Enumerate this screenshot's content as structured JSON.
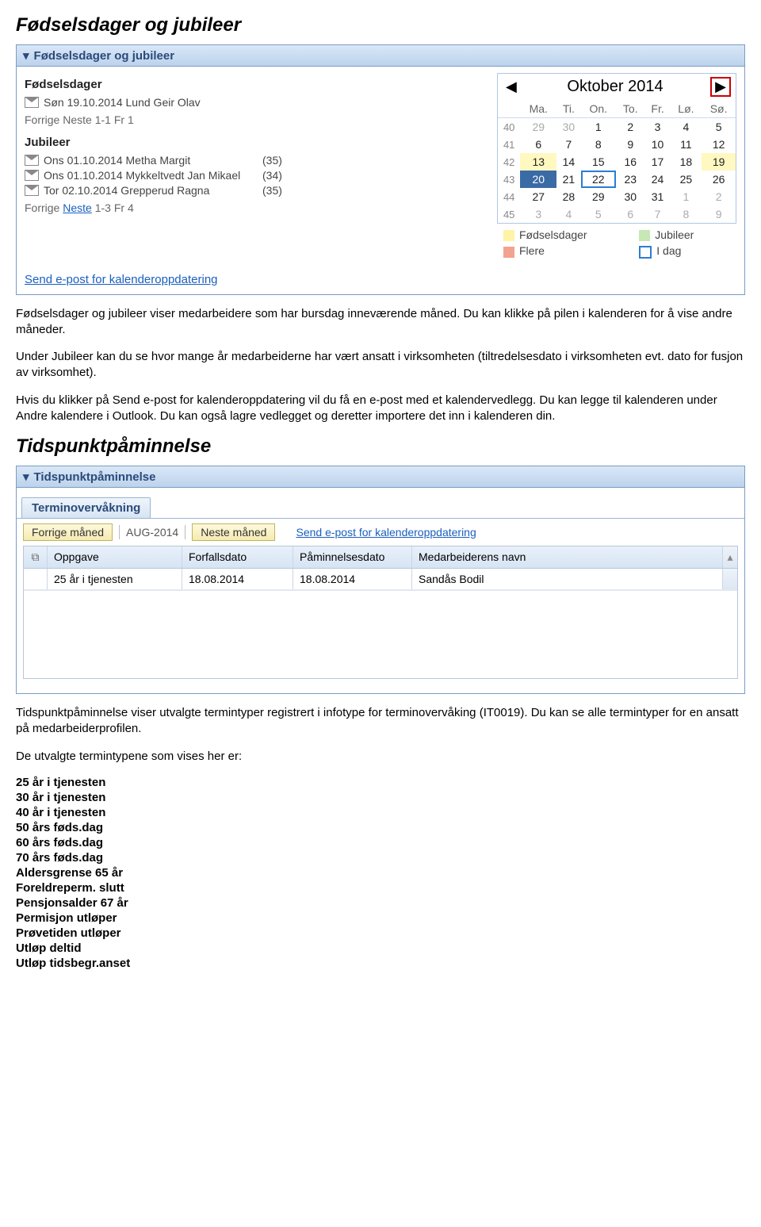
{
  "section1": {
    "heading": "Fødselsdager og jubileer",
    "panel_title": "Fødselsdager og jubileer",
    "fodselsdager_label": "Fødselsdager",
    "fodselsdager_entries": [
      "Søn 19.10.2014 Lund Geir Olav"
    ],
    "fodselsdager_pager": {
      "forrige": "Forrige",
      "neste": "Neste",
      "range": "1-1 Fr 1"
    },
    "jubileer_label": "Jubileer",
    "jubileer_entries": [
      {
        "text": "Ons 01.10.2014 Metha Margit",
        "age": "(35)"
      },
      {
        "text": "Ons 01.10.2014 Mykkeltvedt Jan Mikael",
        "age": "(34)"
      },
      {
        "text": "Tor  02.10.2014 Grepperud Ragna",
        "age": "(35)"
      }
    ],
    "jubileer_pager": {
      "forrige": "Forrige",
      "neste": "Neste",
      "range": "1-3 Fr 4"
    },
    "send_link": "Send e-post for kalenderoppdatering",
    "calendar": {
      "month_title": "Oktober 2014",
      "dow": [
        "Ma.",
        "Ti.",
        "On.",
        "To.",
        "Fr.",
        "Lø.",
        "Sø."
      ],
      "weeks": [
        {
          "wk": "40",
          "days": [
            {
              "d": "29",
              "dim": true
            },
            {
              "d": "30",
              "dim": true
            },
            {
              "d": "1"
            },
            {
              "d": "2"
            },
            {
              "d": "3"
            },
            {
              "d": "4"
            },
            {
              "d": "5"
            }
          ]
        },
        {
          "wk": "41",
          "days": [
            {
              "d": "6"
            },
            {
              "d": "7"
            },
            {
              "d": "8"
            },
            {
              "d": "9"
            },
            {
              "d": "10"
            },
            {
              "d": "11"
            },
            {
              "d": "12"
            }
          ]
        },
        {
          "wk": "42",
          "days": [
            {
              "d": "13",
              "hl": true
            },
            {
              "d": "14"
            },
            {
              "d": "15"
            },
            {
              "d": "16"
            },
            {
              "d": "17"
            },
            {
              "d": "18"
            },
            {
              "d": "19",
              "hl": true
            }
          ]
        },
        {
          "wk": "43",
          "days": [
            {
              "d": "20",
              "sel": true
            },
            {
              "d": "21"
            },
            {
              "d": "22",
              "today": true
            },
            {
              "d": "23"
            },
            {
              "d": "24"
            },
            {
              "d": "25"
            },
            {
              "d": "26"
            }
          ]
        },
        {
          "wk": "44",
          "days": [
            {
              "d": "27"
            },
            {
              "d": "28"
            },
            {
              "d": "29"
            },
            {
              "d": "30"
            },
            {
              "d": "31"
            },
            {
              "d": "1",
              "dim": true
            },
            {
              "d": "2",
              "dim": true
            }
          ]
        },
        {
          "wk": "45",
          "days": [
            {
              "d": "3",
              "dim": true
            },
            {
              "d": "4",
              "dim": true
            },
            {
              "d": "5",
              "dim": true
            },
            {
              "d": "6",
              "dim": true
            },
            {
              "d": "7",
              "dim": true
            },
            {
              "d": "8",
              "dim": true
            },
            {
              "d": "9",
              "dim": true
            }
          ]
        }
      ],
      "legend": {
        "fodselsdager": "Fødselsdager",
        "jubileer": "Jubileer",
        "flere": "Flere",
        "idag": "I dag"
      }
    },
    "paragraphs": [
      "Fødselsdager og jubileer viser medarbeidere som har bursdag inneværende måned. Du kan klikke på pilen i kalenderen for å vise andre måneder.",
      "Under Jubileer kan du se hvor mange år medarbeiderne har vært ansatt i virksomheten (tiltredelsesdato i virksomheten evt. dato for fusjon av virksomhet).",
      "Hvis du klikker på Send e-post for kalenderoppdatering vil du få en e-post med et kalendervedlegg. Du kan legge til kalenderen under Andre kalendere i Outlook. Du kan også lagre vedlegget og deretter importere det inn i kalenderen din."
    ]
  },
  "section2": {
    "heading": "Tidspunktpåminnelse",
    "panel_title": "Tidspunktpåminnelse",
    "tab_label": "Terminovervåkning",
    "toolbar": {
      "prev": "Forrige måned",
      "month": "AUG-2014",
      "next": "Neste måned",
      "send": "Send e-post for kalenderoppdatering"
    },
    "columns": {
      "oppgave": "Oppgave",
      "forfall": "Forfallsdato",
      "paminn": "Påminnelsesdato",
      "navn": "Medarbeiderens navn"
    },
    "rows": [
      {
        "oppgave": "25 år i tjenesten",
        "forfall": "18.08.2014",
        "paminn": "18.08.2014",
        "navn": "Sandås Bodil"
      }
    ],
    "paragraphs": [
      "Tidspunktpåminnelse viser utvalgte termintyper registrert i infotype for terminovervåking (IT0019). Du kan se alle termintyper for en ansatt på medarbeiderprofilen.",
      "De utvalgte termintypene som vises her er:"
    ],
    "termlist": [
      "25 år i tjenesten",
      "30 år i tjenesten",
      "40 år i tjenesten",
      "50 års føds.dag",
      "60 års føds.dag",
      "70 års føds.dag",
      "Aldersgrense 65 år",
      "Foreldreperm. slutt",
      "Pensjonsalder 67 år",
      "Permisjon utløper",
      "Prøvetiden utløper",
      "Utløp deltid",
      "Utløp tidsbegr.anset"
    ]
  }
}
